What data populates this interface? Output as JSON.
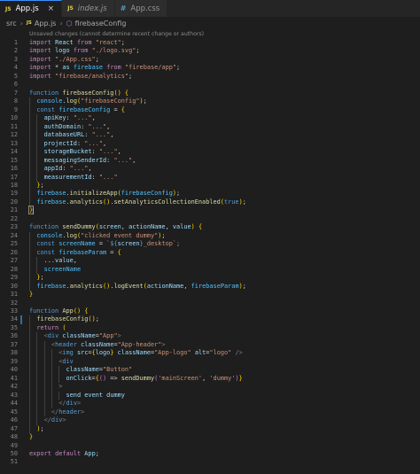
{
  "tabs": [
    {
      "icon": "JS",
      "label": "App.js",
      "close": "×"
    },
    {
      "icon": "JS",
      "label": "index.js"
    },
    {
      "icon": "#",
      "label": "App.css"
    }
  ],
  "breadcrumb": {
    "folder": "src",
    "file_icon": "JS",
    "file": "App.js",
    "symbol": "firebaseConfig"
  },
  "hint": "Unsaved changes (cannot determine recent change or authors)",
  "lines": [
    "import React from \"react\";",
    "import logo from \"./logo.svg\";",
    "import \"./App.css\";",
    "import * as firebase from \"firebase/app\";",
    "import \"firebase/analytics\";",
    "",
    "function firebaseConfig() {",
    "  console.log(\"firebaseConfig\");",
    "  const firebaseConfig = {",
    "    apiKey: \"...\",",
    "    authDomain: \"...\",",
    "    databaseURL: \"...\",",
    "    projectId: \"...\",",
    "    storageBucket: \"...\",",
    "    messagingSenderId: \"...\",",
    "    appId: \"...\",",
    "    measurementId: \"...\"",
    "  };",
    "  firebase.initializeApp(firebaseConfig);",
    "  firebase.analytics().setAnalyticsCollectionEnabled(true);",
    "}",
    "",
    "function sendDummy(screen, actionName, value) {",
    "  console.log(\"clicked event dummy\");",
    "  const screenName = `${screen}_desktop`;",
    "  const firebaseParam = {",
    "    ...value,",
    "    screenName",
    "  };",
    "  firebase.analytics().logEvent(actionName, firebaseParam);",
    "}",
    "",
    "function App() {",
    "  firebaseConfig();",
    "  return (",
    "    <div className=\"App\">",
    "      <header className=\"App-header\">",
    "        <img src={logo} className=\"App-logo\" alt=\"logo\" />",
    "        <div",
    "          className=\"Button\"",
    "          onClick={() => sendDummy('mainScreen', 'dummy')}",
    "        >",
    "          send event dummy",
    "        </div>",
    "      </header>",
    "    </div>",
    "  );",
    "}",
    "",
    "export default App;",
    ""
  ]
}
